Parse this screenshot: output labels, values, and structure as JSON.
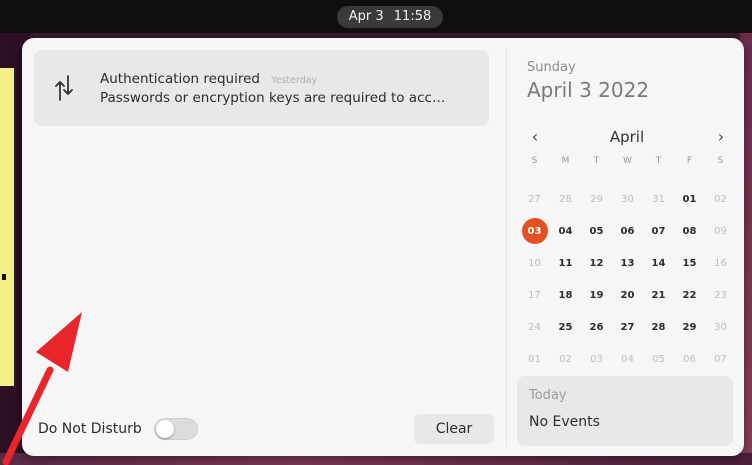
{
  "topbar": {
    "date": "Apr 3",
    "time": "11:58"
  },
  "notification": {
    "title": "Authentication required",
    "time": "Yesterday",
    "body": "Passwords or encryption keys are required to acc…",
    "icon": "key-sync-icon"
  },
  "controls": {
    "dnd_label": "Do Not Disturb",
    "dnd_enabled": false,
    "clear_label": "Clear"
  },
  "calendar": {
    "weekday": "Sunday",
    "full_date": "April 3 2022",
    "month": "April",
    "weekdays": [
      "S",
      "M",
      "T",
      "W",
      "T",
      "F",
      "S"
    ],
    "weeks": [
      [
        {
          "d": "27",
          "dim": true
        },
        {
          "d": "28",
          "dim": true
        },
        {
          "d": "29",
          "dim": true
        },
        {
          "d": "30",
          "dim": true
        },
        {
          "d": "31",
          "dim": true
        },
        {
          "d": "01"
        },
        {
          "d": "02",
          "dim": true
        }
      ],
      [
        {
          "d": "03",
          "today": true
        },
        {
          "d": "04"
        },
        {
          "d": "05"
        },
        {
          "d": "06"
        },
        {
          "d": "07"
        },
        {
          "d": "08"
        },
        {
          "d": "09",
          "dim": true
        }
      ],
      [
        {
          "d": "10",
          "dim": true
        },
        {
          "d": "11"
        },
        {
          "d": "12"
        },
        {
          "d": "13"
        },
        {
          "d": "14"
        },
        {
          "d": "15"
        },
        {
          "d": "16",
          "dim": true
        }
      ],
      [
        {
          "d": "17",
          "dim": true
        },
        {
          "d": "18"
        },
        {
          "d": "19"
        },
        {
          "d": "20"
        },
        {
          "d": "21"
        },
        {
          "d": "22"
        },
        {
          "d": "23",
          "dim": true
        }
      ],
      [
        {
          "d": "24",
          "dim": true
        },
        {
          "d": "25"
        },
        {
          "d": "26"
        },
        {
          "d": "27"
        },
        {
          "d": "28"
        },
        {
          "d": "29"
        },
        {
          "d": "30",
          "dim": true
        }
      ],
      [
        {
          "d": "01",
          "dim": true
        },
        {
          "d": "02",
          "dim": true
        },
        {
          "d": "03",
          "dim": true
        },
        {
          "d": "04",
          "dim": true
        },
        {
          "d": "05",
          "dim": true
        },
        {
          "d": "06",
          "dim": true
        },
        {
          "d": "07",
          "dim": true
        }
      ]
    ]
  },
  "events": {
    "title": "Today",
    "body": "No Events"
  },
  "colors": {
    "accent": "#e2511f",
    "annotation": "#e8252b"
  }
}
